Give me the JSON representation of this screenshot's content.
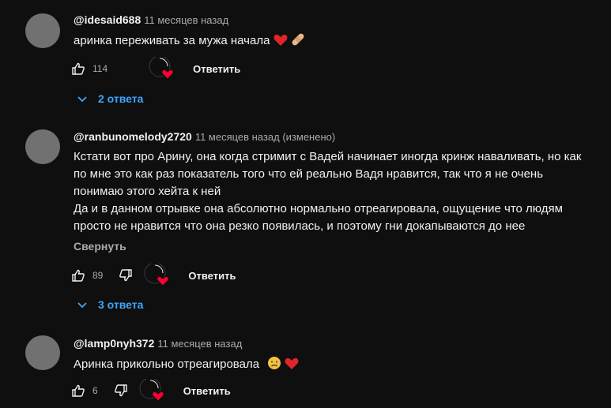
{
  "comments": [
    {
      "author": "@idesaid688",
      "time": "11 месяцев назад",
      "lines": [
        "аринка переживать за мужа начала"
      ],
      "likes": "114",
      "reply_label": "Ответить",
      "replies_label": "2 ответа"
    },
    {
      "author": "@ranbunomelody2720",
      "time": "11 месяцев назад (изменено)",
      "lines": [
        "Кстати вот про Арину, она когда стримит с Вадей начинает иногда кринж наваливать, но как",
        "по мне это как раз показатель того что ей реально Вадя нравится, так что я не очень",
        "понимаю этого хейта к ней",
        "Да и в данном отрывке она абсолютно нормально отреагировала, ощущение что людям",
        "просто не нравится что она резко появилась, и поэтому гни докапываются до нее"
      ],
      "collapse_label": "Свернуть",
      "likes": "89",
      "reply_label": "Ответить",
      "replies_label": "3 ответа"
    },
    {
      "author": "@lamp0nyh372",
      "time": "11 месяцев назад",
      "lines": [
        "Аринка прикольно отреагировала"
      ],
      "likes": "6",
      "reply_label": "Ответить"
    }
  ],
  "icons": {
    "like": "thumbs-up-icon",
    "dislike": "thumbs-down-icon",
    "creator_heart": "creator-heart-icon",
    "expand": "chevron-down-icon",
    "heart_emoji": "red-heart-emoji",
    "bandage_emoji": "bandage-emoji",
    "tear_emoji": "sad-face-emoji"
  },
  "colors": {
    "background": "#0f0f0f",
    "link": "#3ea6ff",
    "heart": "#ff0033",
    "muted": "#aaaaaa"
  }
}
